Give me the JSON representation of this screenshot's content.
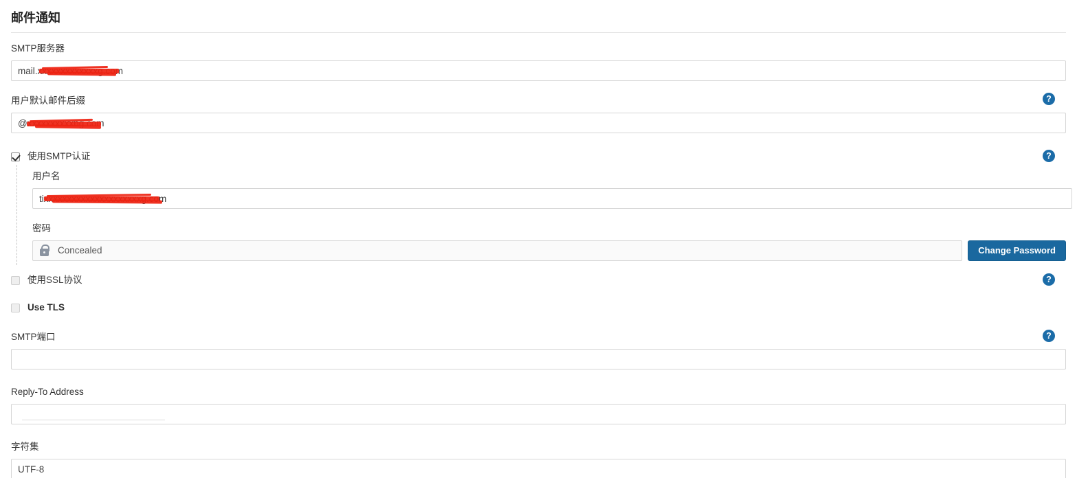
{
  "section": {
    "title": "邮件通知"
  },
  "fields": {
    "smtp_server": {
      "label": "SMTP服务器",
      "value": "mail.xxxxxxxxxxxxxg.com",
      "value_prefix": "mail.",
      "value_suffix": "g.com",
      "redacted": true
    },
    "default_suffix": {
      "label": "用户默认邮件后缀",
      "value": "@xxxxxxxxxxng.com",
      "value_prefix": "@",
      "value_suffix": "ng.com",
      "redacted": true,
      "help": "?"
    },
    "use_smtp_auth": {
      "label": "使用SMTP认证",
      "checked": true,
      "help": "?"
    },
    "username": {
      "label": "用户名",
      "value": "tixxxxxxxxxxxxxxxxxxxxxg.com",
      "value_prefix": "ti",
      "value_suffix": "g.com",
      "redacted": true
    },
    "password": {
      "label": "密码",
      "value": "Concealed",
      "icon": "lock-icon",
      "button_label": "Change Password"
    },
    "use_ssl": {
      "label": "使用SSL协议",
      "checked": false,
      "disabled": true,
      "help": "?"
    },
    "use_tls": {
      "label": "Use TLS",
      "checked": false,
      "disabled": true
    },
    "smtp_port": {
      "label": "SMTP端口",
      "value": "",
      "placeholder": "",
      "help": "?"
    },
    "reply_to": {
      "label": "Reply-To Address",
      "value": "",
      "placeholder": ""
    },
    "charset": {
      "label": "字符集",
      "value": "UTF-8",
      "placeholder": ""
    }
  },
  "colors": {
    "accent": "#1b6ca8",
    "button": "#1a689f",
    "redaction": "#ee2211",
    "border": "#d5d5d5",
    "text": "#333333"
  }
}
